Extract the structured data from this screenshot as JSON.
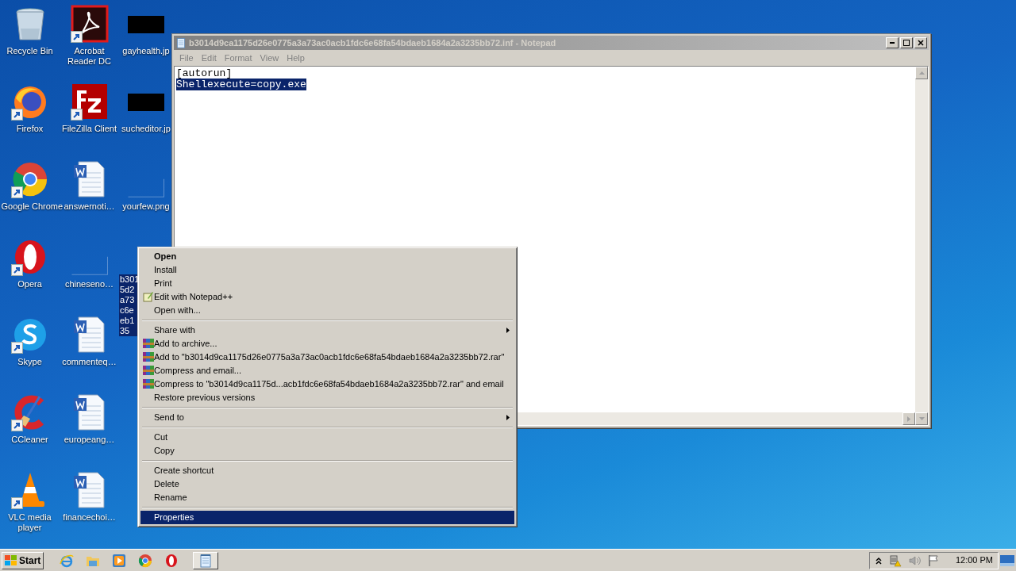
{
  "desktop_icons": [
    {
      "kind": "recycle",
      "label": "Recycle Bin",
      "shortcut": false,
      "selected": false
    },
    {
      "kind": "firefox",
      "label": "Firefox",
      "shortcut": true,
      "selected": false
    },
    {
      "kind": "chrome",
      "label": "Google Chrome",
      "shortcut": true,
      "selected": false
    },
    {
      "kind": "opera",
      "label": "Opera",
      "shortcut": true,
      "selected": false
    },
    {
      "kind": "skype",
      "label": "Skype",
      "shortcut": true,
      "selected": false
    },
    {
      "kind": "ccleaner",
      "label": "CCleaner",
      "shortcut": true,
      "selected": false
    },
    {
      "kind": "vlc",
      "label": "VLC media player",
      "shortcut": true,
      "selected": false
    },
    {
      "kind": "acrobat",
      "label": "Acrobat Reader DC",
      "shortcut": true,
      "selected": false
    },
    {
      "kind": "filezilla",
      "label": "FileZilla Client",
      "shortcut": true,
      "selected": false
    },
    {
      "kind": "word",
      "label": "answernoti…",
      "shortcut": false,
      "selected": false
    },
    {
      "kind": "blank",
      "label": "chineseno…",
      "shortcut": false,
      "selected": false
    },
    {
      "kind": "word",
      "label": "commenteq…",
      "shortcut": false,
      "selected": false
    },
    {
      "kind": "word",
      "label": "europeang…",
      "shortcut": false,
      "selected": false
    },
    {
      "kind": "word",
      "label": "financechoi…",
      "shortcut": false,
      "selected": false
    },
    {
      "kind": "dark",
      "label": "gayhealth.jp",
      "shortcut": false,
      "selected": false
    },
    {
      "kind": "dark",
      "label": "sucheditor.jp",
      "shortcut": false,
      "selected": false
    },
    {
      "kind": "blank",
      "label": "yourfew.png",
      "shortcut": false,
      "selected": false
    },
    {
      "kind": "hidden",
      "lines": [
        "b301",
        "5d2",
        "a73",
        "c6e",
        "eb1",
        "35"
      ],
      "selected": true
    }
  ],
  "notepad": {
    "title": "b3014d9ca1175d26e0775a3a73ac0acb1fdc6e68fa54bdaeb1684a2a3235bb72.inf - Notepad",
    "menu": [
      "File",
      "Edit",
      "Format",
      "View",
      "Help"
    ],
    "lines": [
      {
        "text": "[autorun]",
        "selected": false
      },
      {
        "text": "Shellexecute=copy.exe",
        "selected": true
      }
    ]
  },
  "context_menu": [
    {
      "kind": "item",
      "label": "Open",
      "default": true,
      "submenu": false,
      "selected": false
    },
    {
      "kind": "item",
      "label": "Install",
      "default": false,
      "submenu": false,
      "selected": false
    },
    {
      "kind": "item",
      "label": "Print",
      "default": false,
      "submenu": false,
      "selected": false
    },
    {
      "kind": "notepad",
      "label": "Edit with Notepad++",
      "default": false,
      "submenu": false,
      "selected": false
    },
    {
      "kind": "item",
      "label": "Open with...",
      "default": false,
      "submenu": false,
      "selected": false
    },
    {
      "kind": "separator"
    },
    {
      "kind": "item",
      "label": "Share with",
      "default": false,
      "submenu": true,
      "selected": false
    },
    {
      "kind": "archive",
      "label": "Add to archive...",
      "default": false,
      "submenu": false,
      "selected": false
    },
    {
      "kind": "archive",
      "label": "Add to \"b3014d9ca1175d26e0775a3a73ac0acb1fdc6e68fa54bdaeb1684a2a3235bb72.rar\"",
      "default": false,
      "submenu": false,
      "selected": false
    },
    {
      "kind": "archive",
      "label": "Compress and email...",
      "default": false,
      "submenu": false,
      "selected": false
    },
    {
      "kind": "archive",
      "label": "Compress to \"b3014d9ca1175d...acb1fdc6e68fa54bdaeb1684a2a3235bb72.rar\" and email",
      "default": false,
      "submenu": false,
      "selected": false
    },
    {
      "kind": "item",
      "label": "Restore previous versions",
      "default": false,
      "submenu": false,
      "selected": false
    },
    {
      "kind": "separator"
    },
    {
      "kind": "item",
      "label": "Send to",
      "default": false,
      "submenu": true,
      "selected": false
    },
    {
      "kind": "separator"
    },
    {
      "kind": "item",
      "label": "Cut",
      "default": false,
      "submenu": false,
      "selected": false
    },
    {
      "kind": "item",
      "label": "Copy",
      "default": false,
      "submenu": false,
      "selected": false
    },
    {
      "kind": "separator"
    },
    {
      "kind": "item",
      "label": "Create shortcut",
      "default": false,
      "submenu": false,
      "selected": false
    },
    {
      "kind": "item",
      "label": "Delete",
      "default": false,
      "submenu": false,
      "selected": false
    },
    {
      "kind": "item",
      "label": "Rename",
      "default": false,
      "submenu": false,
      "selected": false
    },
    {
      "kind": "separator"
    },
    {
      "kind": "item",
      "label": "Properties",
      "default": false,
      "submenu": false,
      "selected": true
    }
  ],
  "taskbar": {
    "start": "Start",
    "quick_launch": [
      {
        "kind": "ie"
      },
      {
        "kind": "folder"
      },
      {
        "kind": "media"
      },
      {
        "kind": "chrome"
      },
      {
        "kind": "opera"
      }
    ],
    "tasks": [
      {
        "kind": "notepad"
      }
    ],
    "tray": [
      {
        "kind": "chevron"
      },
      {
        "kind": "network"
      },
      {
        "kind": "speaker"
      },
      {
        "kind": "flag"
      }
    ],
    "clock": "12:00 PM"
  }
}
